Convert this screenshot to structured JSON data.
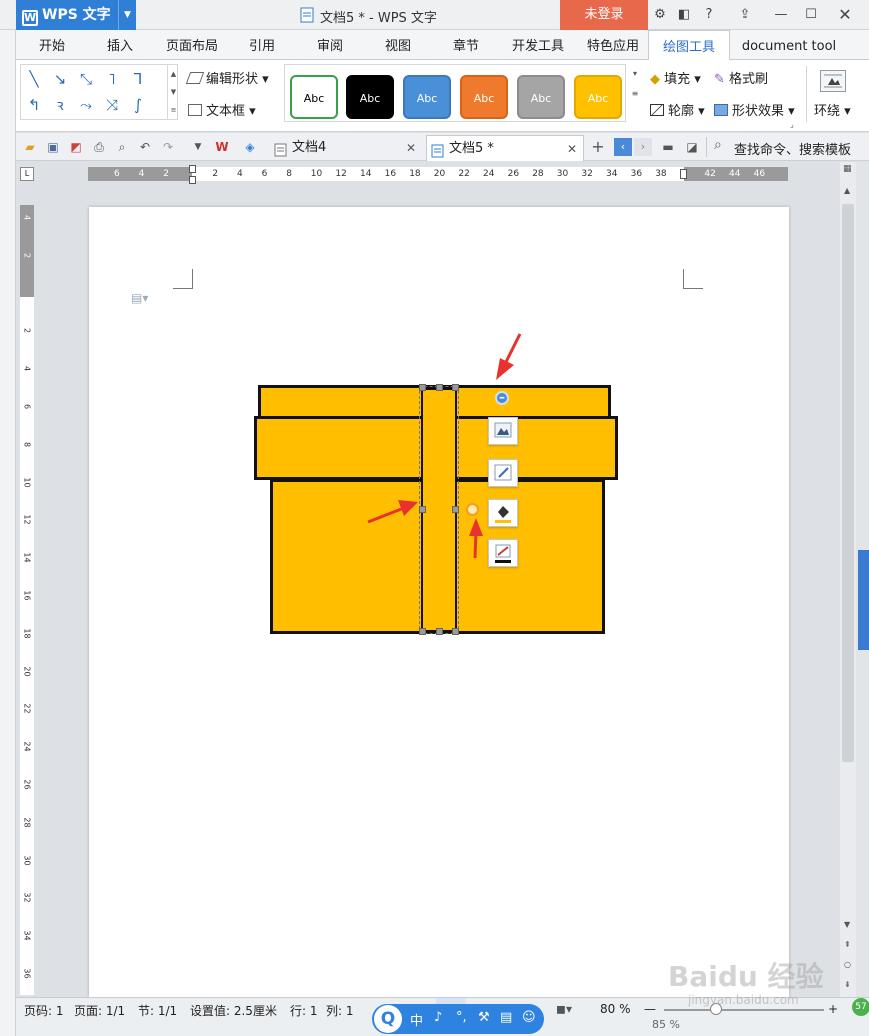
{
  "titlebar": {
    "app_name": "WPS 文字",
    "doc_title": "文档5 * - WPS 文字",
    "login": "未登录"
  },
  "ribbon_tabs": [
    "开始",
    "插入",
    "页面布局",
    "引用",
    "审阅",
    "视图",
    "章节",
    "开发工具",
    "特色应用",
    "绘图工具",
    "document tool"
  ],
  "active_tab": "绘图工具",
  "ribbon": {
    "edit_shape": "编辑形状",
    "text_box": "文本框",
    "style_swatches": [
      {
        "label": "Abc",
        "bg": "#ffffff",
        "fg": "#000000",
        "border": "#3aa04a"
      },
      {
        "label": "Abc",
        "bg": "#000000",
        "fg": "#ffffff",
        "border": "#000000"
      },
      {
        "label": "Abc",
        "bg": "#4a90d9",
        "fg": "#ffffff",
        "border": "#3a78c0"
      },
      {
        "label": "Abc",
        "bg": "#ef7a2e",
        "fg": "#ffffff",
        "border": "#d56418"
      },
      {
        "label": "Abc",
        "bg": "#a5a5a5",
        "fg": "#ffffff",
        "border": "#8c8c8c"
      },
      {
        "label": "Abc",
        "bg": "#ffc000",
        "fg": "#ffffff",
        "border": "#e0a800"
      }
    ],
    "fill": "填充",
    "format_painter": "格式刷",
    "outline": "轮廓",
    "shape_effects": "形状效果",
    "wrap": "环绕"
  },
  "doc_tabs": [
    {
      "label": "文档4",
      "active": false
    },
    {
      "label": "文档5 *",
      "active": true
    }
  ],
  "search_placeholder": "查找命令、搜索模板",
  "ruler": {
    "h_labels": [
      "6",
      "4",
      "2",
      "",
      "2",
      "4",
      "6",
      "8",
      "10",
      "12",
      "14",
      "16",
      "18",
      "20",
      "22",
      "24",
      "26",
      "28",
      "30",
      "32",
      "34",
      "36",
      "38",
      "",
      "42",
      "44",
      "46"
    ],
    "v_labels": [
      "4",
      "2",
      "",
      "2",
      "4",
      "6",
      "8",
      "10",
      "12",
      "14",
      "16",
      "18",
      "20",
      "22",
      "24",
      "26",
      "28",
      "30",
      "32",
      "34",
      "36",
      "38"
    ]
  },
  "statusbar": {
    "page_code": "页码: 1",
    "page": "页面: 1/1",
    "section": "节: 1/1",
    "setting": "设置值: 2.5厘米",
    "row": "行: 1",
    "col": "列: 1",
    "zoom": "80 %",
    "zoom2": "85 %"
  },
  "ime": {
    "chars": [
      "中",
      "♪",
      "°,",
      "⚒",
      "▤",
      "☺"
    ]
  },
  "watermark": "Baidu 经验",
  "watermark_url": "jingyan.baidu.com",
  "colors": {
    "accent": "#2f7fd6",
    "login": "#e8684c",
    "gift_yellow": "#ffbe00",
    "arrow_red": "#e8322d"
  }
}
